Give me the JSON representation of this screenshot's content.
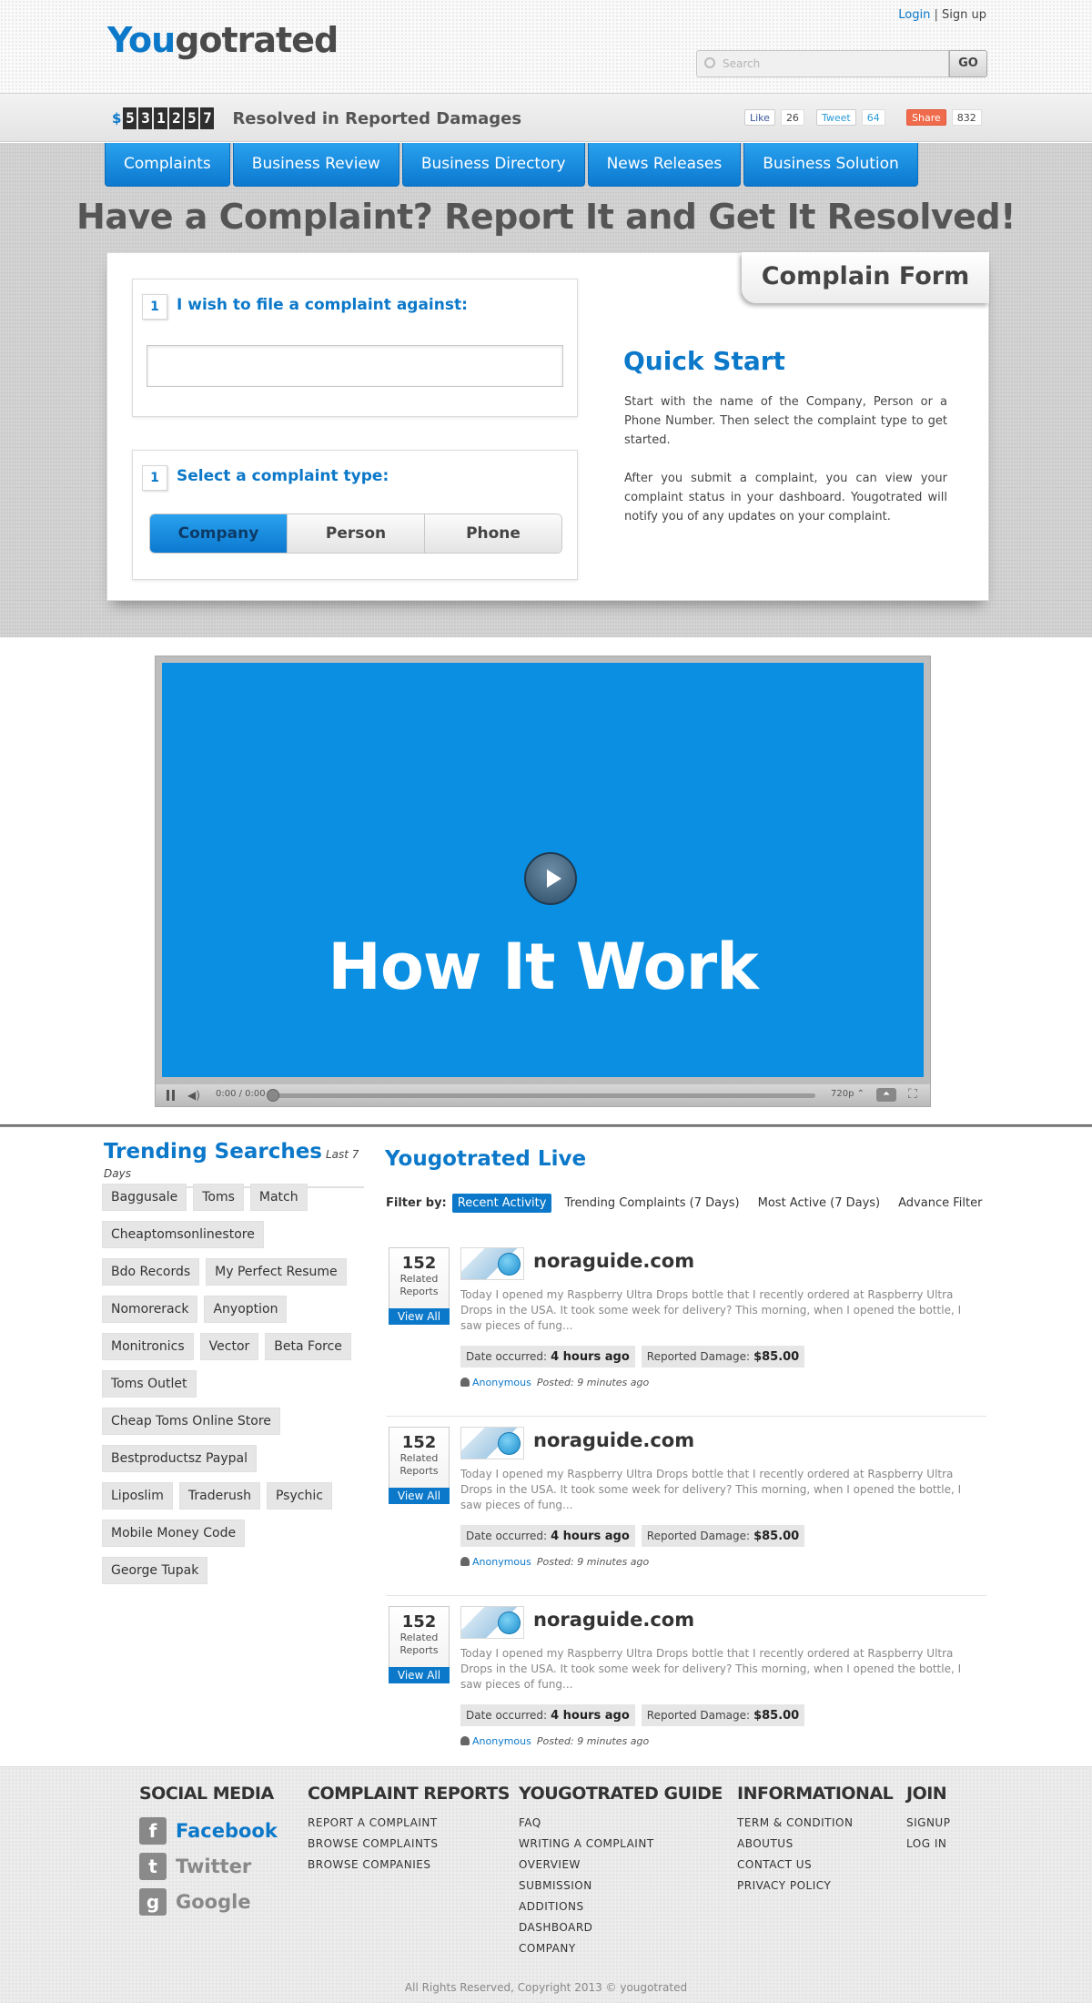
{
  "header": {
    "logo_part1": "You",
    "logo_part2": "gotrated",
    "login": "Login",
    "separator": "|",
    "signup": "Sign up",
    "search_placeholder": "Search",
    "go": "GO"
  },
  "stats": {
    "currency": "$",
    "digits": [
      "5",
      "3",
      "1",
      "2",
      "5",
      "7"
    ],
    "label": "Resolved in Reported Damages",
    "fb_like": "Like",
    "fb_count": "26",
    "tweet": "Tweet",
    "tweet_count": "64",
    "share": "Share",
    "share_count": "832"
  },
  "nav": [
    "Complaints",
    "Business Review",
    "Business Directory",
    "News Releases",
    "Business Solution"
  ],
  "hero": {
    "title": "Have a Complaint? Report It and Get It Resolved!",
    "form_ribbon": "Complain Form",
    "step1_num": "1",
    "step1_title": "I wish to file a complaint against:",
    "step2_num": "1",
    "step2_title": "Select a complaint type:",
    "types": [
      "Company",
      "Person",
      "Phone"
    ],
    "selected_type": "Company",
    "quick_start_title": "Quick Start",
    "quick_start_p1": "Start with the name of the Company, Person or a Phone Number. Then select the complaint type to get started.",
    "quick_start_p2": "After you submit a complaint, you can view your complaint status in your dashboard. Yougotrated will notify you of any updates on your complaint."
  },
  "video": {
    "title": "How It Work",
    "time": "0:00 / 0:00",
    "quality": "720p",
    "progress": 0
  },
  "trending": {
    "title": "Trending  Searches",
    "subtitle": "Last 7 Days",
    "rows": [
      [
        "Baggusale",
        "Toms",
        "Match"
      ],
      [
        "Cheaptomsonlinestore"
      ],
      [
        "Bdo Records",
        "My Perfect Resume"
      ],
      [
        "Nomorerack",
        "Anyoption"
      ],
      [
        "Monitronics",
        "Vector",
        "Beta Force"
      ],
      [
        "Toms Outlet"
      ],
      [
        "Cheap Toms Online Store"
      ],
      [
        "Bestproductsz  Paypal"
      ],
      [
        "Liposlim",
        "Traderush",
        "Psychic"
      ],
      [
        "Mobile Money Code"
      ],
      [
        "George Tupak"
      ]
    ]
  },
  "live": {
    "title": "Yougotrated Live",
    "filter_label": "Filter by:",
    "filters": [
      "Recent Activity",
      "Trending Complaints (7 Days)",
      "Most Active (7 Days)",
      "Advance Filter"
    ],
    "active_filter": "Recent Activity",
    "items": [
      {
        "count": "152",
        "count_label1": "Related",
        "count_label2": "Reports",
        "view_all": "View All",
        "title": "noraguide.com",
        "desc": "Today I opened my Raspberry Ultra Drops bottle that I recently ordered at Raspberry Ultra Drops in the USA. It took some week for delivery? This morning, when I opened the bottle, I saw pieces of fung...",
        "date_label": "Date occurred:",
        "date_value": "4 hours ago",
        "damage_label": "Reported Damage:",
        "damage_value": "$85.00",
        "user": "Anonymous",
        "posted": "Posted: 9 minutes ago"
      },
      {
        "count": "152",
        "count_label1": "Related",
        "count_label2": "Reports",
        "view_all": "View All",
        "title": "noraguide.com",
        "desc": "Today I opened my Raspberry Ultra Drops bottle that I recently ordered at Raspberry Ultra Drops in the USA. It took some week for delivery? This morning, when I opened the bottle, I saw pieces of fung...",
        "date_label": "Date occurred:",
        "date_value": "4 hours ago",
        "damage_label": "Reported Damage:",
        "damage_value": "$85.00",
        "user": "Anonymous",
        "posted": "Posted: 9 minutes ago"
      },
      {
        "count": "152",
        "count_label1": "Related",
        "count_label2": "Reports",
        "view_all": "View All",
        "title": "noraguide.com",
        "desc": "Today I opened my Raspberry Ultra Drops bottle that I recently ordered at Raspberry Ultra Drops in the USA. It took some week for delivery? This morning, when I opened the bottle, I saw pieces of fung...",
        "date_label": "Date occurred:",
        "date_value": "4 hours ago",
        "damage_label": "Reported Damage:",
        "damage_value": "$85.00",
        "user": "Anonymous",
        "posted": "Posted: 9 minutes ago"
      }
    ]
  },
  "footer": {
    "social": {
      "title": "SOCIAL MEDIA",
      "items": [
        {
          "icon": "f",
          "label": "Facebook"
        },
        {
          "icon": "t",
          "label": "Twitter"
        },
        {
          "icon": "g",
          "label": "Google"
        }
      ]
    },
    "complaint_reports": {
      "title": "COMPLAINT REPORTS",
      "links": [
        "REPORT A COMPLAINT",
        "BROWSE COMPLAINTS",
        "BROWSE COMPANIES"
      ]
    },
    "guide": {
      "title": "YOUGOTRATED GUIDE",
      "links": [
        "FAQ",
        "WRITING A COMPLAINT",
        "OVERVIEW",
        "SUBMISSION",
        "ADDITIONS",
        "DASHBOARD",
        "COMPANY"
      ]
    },
    "informational": {
      "title": "INFORMATIONAL",
      "links": [
        "TERM & CONDITION",
        "ABOUTUS",
        "CONTACT US",
        "PRIVACY POLICY"
      ]
    },
    "join": {
      "title": "JOIN",
      "links": [
        "SIGNUP",
        "LOG IN"
      ]
    },
    "copyright": "All Rights Reserved, Copyright 2013 © yougotrated"
  },
  "colors": {
    "brand_blue": "#0b78c9",
    "video_blue": "#0a8fe2"
  }
}
